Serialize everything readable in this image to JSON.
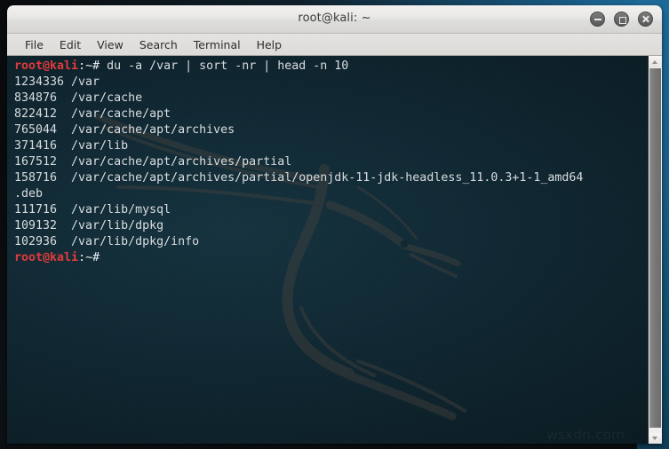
{
  "window": {
    "title": "root@kali: ~",
    "controls": {
      "minimize_label": "Minimize",
      "maximize_label": "Maximize",
      "close_label": "Close"
    }
  },
  "menubar": {
    "items": [
      {
        "label": "File"
      },
      {
        "label": "Edit"
      },
      {
        "label": "View"
      },
      {
        "label": "Search"
      },
      {
        "label": "Terminal"
      },
      {
        "label": "Help"
      }
    ]
  },
  "terminal": {
    "colors": {
      "background": "#0f252f",
      "foreground": "#d9dde0",
      "prompt_user": "#e23b3b",
      "prompt_path": "#e8ecee"
    },
    "prompt_user_host": "root@kali",
    "prompt_suffix": ":~#",
    "command": " du -a /var | sort -nr | head -n 10",
    "output_lines": [
      "1234336 /var",
      "834876  /var/cache",
      "822412  /var/cache/apt",
      "765044  /var/cache/apt/archives",
      "371416  /var/lib",
      "167512  /var/cache/apt/archives/partial",
      "158716  /var/cache/apt/archives/partial/openjdk-11-jdk-headless_11.0.3+1-1_amd64",
      ".deb",
      "111716  /var/lib/mysql",
      "109132  /var/lib/dpkg",
      "102936  /var/lib/dpkg/info"
    ],
    "final_prompt_trailing": " ",
    "watermark": "wsxdn.com"
  },
  "scrollbar": {
    "up_arrow": "scroll-up",
    "down_arrow": "scroll-down"
  }
}
